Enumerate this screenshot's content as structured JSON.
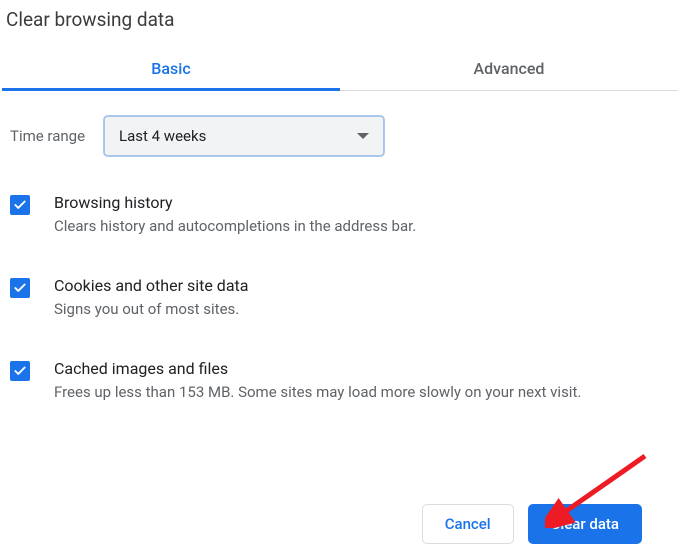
{
  "title": "Clear browsing data",
  "tabs": {
    "basic": "Basic",
    "advanced": "Advanced",
    "active": "basic"
  },
  "time": {
    "label": "Time range",
    "value": "Last 4 weeks"
  },
  "options": [
    {
      "title": "Browsing history",
      "desc": "Clears history and autocompletions in the address bar.",
      "checked": true
    },
    {
      "title": "Cookies and other site data",
      "desc": "Signs you out of most sites.",
      "checked": true
    },
    {
      "title": "Cached images and files",
      "desc": "Frees up less than 153 MB. Some sites may load more slowly on your next visit.",
      "checked": true
    }
  ],
  "buttons": {
    "cancel": "Cancel",
    "clear": "Clear data"
  },
  "colors": {
    "accent": "#1a73e8",
    "muted": "#5f6368"
  }
}
